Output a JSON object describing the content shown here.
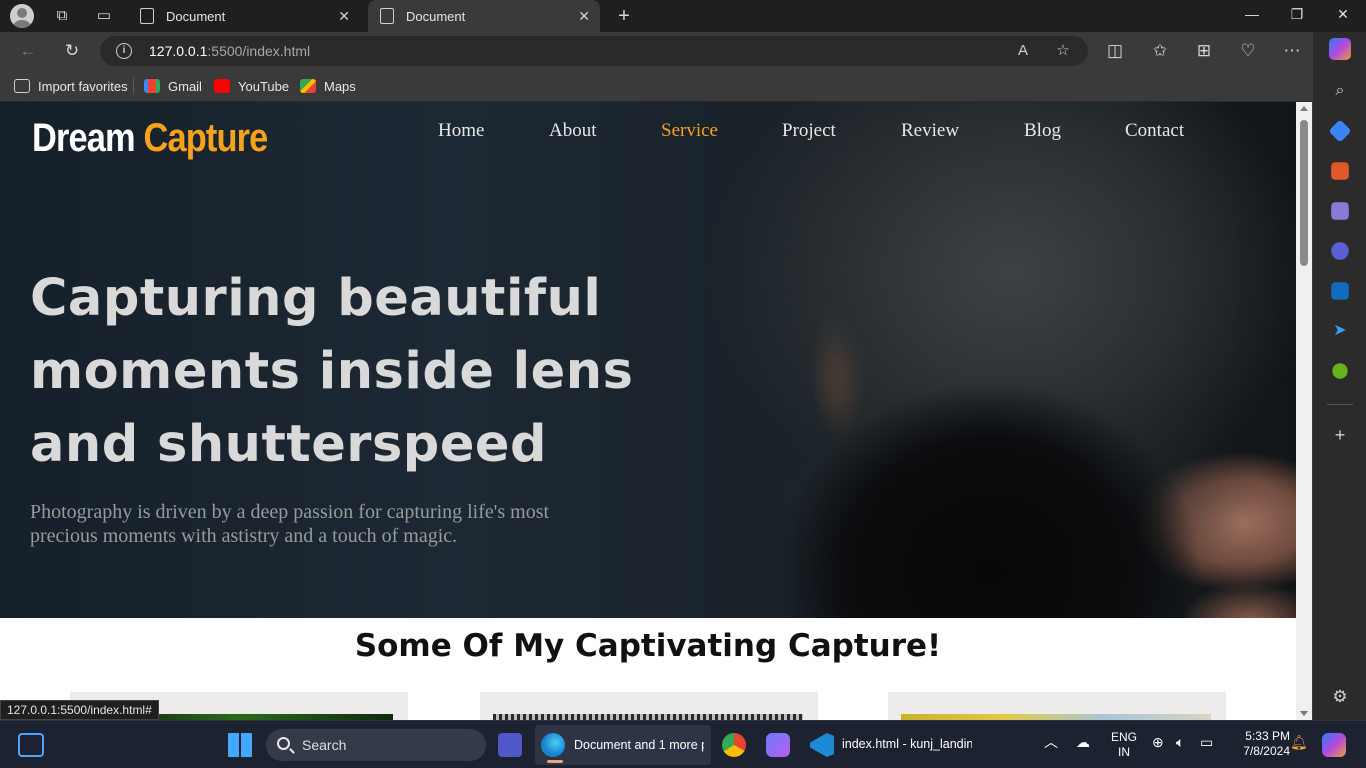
{
  "browser": {
    "tabs": [
      {
        "title": "Document",
        "active": false
      },
      {
        "title": "Document",
        "active": true
      }
    ],
    "address": {
      "host": "127.0.0.1",
      "path": ":5500/index.html"
    },
    "favorites": [
      {
        "label": "Import favorites",
        "icon": "import-icon"
      },
      {
        "label": "Gmail",
        "icon": "gmail-icon"
      },
      {
        "label": "YouTube",
        "icon": "youtube-icon"
      },
      {
        "label": "Maps",
        "icon": "maps-icon"
      }
    ],
    "status_url": "127.0.0.1:5500/index.html#"
  },
  "site": {
    "logo": {
      "first": "Dream",
      "second": "Capture"
    },
    "nav": [
      "Home",
      "About",
      "Service",
      "Project",
      "Review",
      "Blog",
      "Contact"
    ],
    "active_nav": "Service",
    "headline": "Capturing beautiful moments inside lens and shutterspeed",
    "subtext": "Photography is driven by a deep passion for capturing life's most precious moments with astistry and a touch of magic.",
    "section_title": "Some Of My Captivating Capture!"
  },
  "colors": {
    "accent": "#f6a21c",
    "hero_text": "#d9d9d9",
    "taskbar": "#1c2230"
  },
  "taskbar": {
    "search_label": "Search",
    "edge_window": "Document and 1 more p",
    "vscode_window": "index.html - kunj_landin",
    "lang": {
      "line1": "ENG",
      "line2": "IN"
    },
    "time": "5:33 PM",
    "date": "7/8/2024"
  }
}
